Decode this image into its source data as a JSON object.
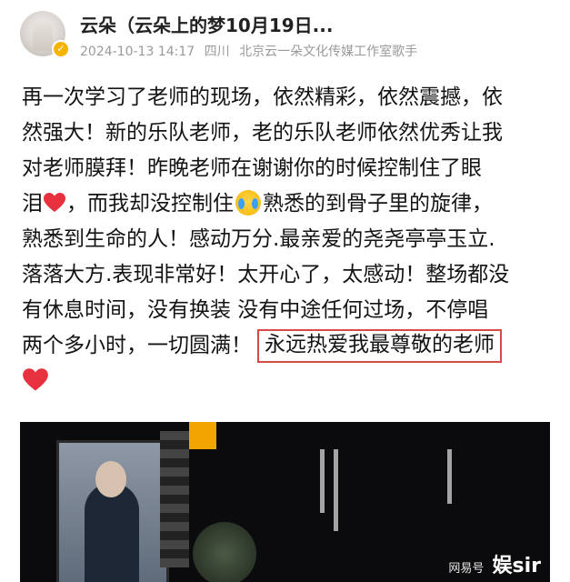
{
  "post": {
    "username": "云朵（云朵上的梦10月19日...",
    "timestamp": "2024-10-13 14:17",
    "location": "四川",
    "user_title": "北京云一朵文化传媒工作室歌手",
    "lines": [
      "再一次学习了老师的现场，依然精彩，依然震撼，依",
      "然强大！新的乐队老师，老的乐队老师依然优秀让我",
      "对老师膜拜！昨晚老师在谢谢你的时候控制住了眼",
      "泪",
      "，而我却没控制住",
      "熟悉的到骨子里的旋律，",
      "熟悉到生命的人！感动万分.最亲爱的尧尧亭亭玉立.",
      "落落大方.表现非常好！太开心了，太感动！整场都没",
      "有休息时间，没有换装 没有中途任何过场，不停唱",
      "两个多小时，一切圆满！",
      "永远热爱我最尊敬的老师"
    ]
  },
  "icons": {
    "verified": "verified-badge-icon",
    "heart": "red-heart-emoji",
    "crying": "crying-face-emoji"
  },
  "colors": {
    "highlight_border": "#d84a45",
    "heart": "#e8313f",
    "meta_text": "#9a9a9a",
    "badge": "#f5b400"
  },
  "watermark": {
    "source": "网易号",
    "brand": "娱sir"
  }
}
